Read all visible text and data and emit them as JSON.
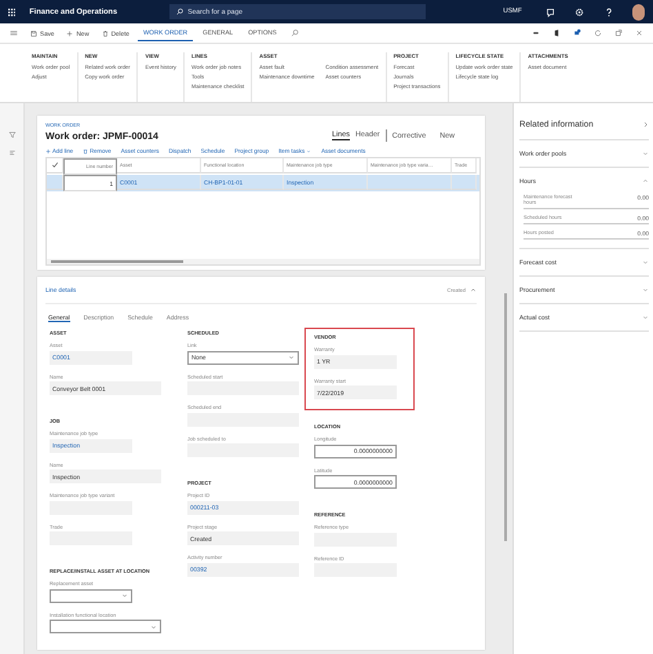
{
  "app": {
    "title": "Finance and Operations",
    "search_placeholder": "Search for a page",
    "company": "USMF"
  },
  "action_bar": {
    "buttons": [
      {
        "label": "Save",
        "kind": "save"
      },
      {
        "label": "New",
        "kind": "new"
      },
      {
        "label": "Delete",
        "kind": "delete"
      }
    ],
    "tabs": [
      {
        "label": "WORK ORDER",
        "selected": true
      },
      {
        "label": "GENERAL",
        "selected": false
      },
      {
        "label": "OPTIONS",
        "selected": false
      }
    ]
  },
  "ribbon": [
    {
      "title": "MAINTAIN",
      "columns": [
        [
          "Work order pool",
          "Adjust"
        ]
      ]
    },
    {
      "title": "NEW",
      "columns": [
        [
          "Related work order",
          "Copy work order"
        ]
      ]
    },
    {
      "title": "VIEW",
      "columns": [
        [
          "Event history"
        ]
      ]
    },
    {
      "title": "LINES",
      "columns": [
        [
          "Work order job notes",
          "Tools",
          "Maintenance checklist"
        ]
      ]
    },
    {
      "title": "ASSET",
      "columns": [
        [
          "Asset fault",
          "Maintenance downtime"
        ],
        [
          "Condition assessment",
          "Asset counters"
        ]
      ]
    },
    {
      "title": "PROJECT",
      "columns": [
        [
          "Forecast",
          "Journals",
          "Project transactions"
        ]
      ]
    },
    {
      "title": "LIFECYCLE STATE",
      "columns": [
        [
          "Update work order state",
          "Lifecycle state log"
        ]
      ]
    },
    {
      "title": "ATTACHMENTS",
      "columns": [
        [
          "Asset document"
        ]
      ]
    }
  ],
  "page": {
    "breadcrumb": "WORK ORDER",
    "title": "Work order: JPMF-00014",
    "view_tabs": [
      {
        "label": "Lines",
        "selected": true
      },
      {
        "label": "Header",
        "selected": false
      }
    ],
    "status": [
      "Corrective",
      "New"
    ]
  },
  "lines_toolbar": [
    {
      "label": "Add line",
      "kind": "add"
    },
    {
      "label": "Remove",
      "kind": "remove"
    },
    {
      "label": "Asset counters",
      "kind": "plain"
    },
    {
      "label": "Dispatch",
      "kind": "plain"
    },
    {
      "label": "Schedule",
      "kind": "plain"
    },
    {
      "label": "Project group",
      "kind": "plain"
    },
    {
      "label": "Item tasks",
      "kind": "menu"
    },
    {
      "label": "Asset documents",
      "kind": "plain"
    }
  ],
  "grid": {
    "columns": [
      "Line number",
      "Asset",
      "Functional location",
      "Maintenance job type",
      "Maintenance job type varia…",
      "Trade"
    ],
    "rows": [
      {
        "selected": true,
        "cells": [
          {
            "text": "1",
            "link": false
          },
          {
            "text": "C0001",
            "link": true
          },
          {
            "text": "CH-BP1-01-01",
            "link": true
          },
          {
            "text": "Inspection",
            "link": true
          }
        ]
      }
    ]
  },
  "line_details": {
    "title": "Line details",
    "status": "Created",
    "expanded": true,
    "tabs": [
      {
        "label": "General",
        "selected": true
      },
      {
        "label": "Description",
        "selected": false
      },
      {
        "label": "Schedule",
        "selected": false
      },
      {
        "label": "Address",
        "selected": false
      }
    ],
    "columns": [
      [
        {
          "title": "ASSET",
          "highlighted": false,
          "fields": [
            {
              "label": "Asset",
              "value": "C0001",
              "kind": "readonly",
              "link": true
            },
            {
              "label": "Name",
              "value": "Conveyor Belt 0001",
              "kind": "readonly",
              "link": false
            }
          ]
        },
        {
          "title": "JOB",
          "highlighted": false,
          "fields": [
            {
              "label": "Maintenance job type",
              "value": "Inspection",
              "kind": "readonly",
              "link": true
            },
            {
              "label": "Name",
              "value": "Inspection",
              "kind": "readonly",
              "link": false
            },
            {
              "label": "Maintenance job type variant",
              "kind": "readonly"
            },
            {
              "label": "Trade",
              "kind": "readonly"
            }
          ]
        },
        {
          "title": "REPLACE/INSTALL ASSET AT LOCATION",
          "highlighted": false,
          "fields": [
            {
              "label": "Replacement asset",
              "kind": "dropdown"
            },
            {
              "label": "Installation functional location",
              "kind": "dropdown"
            }
          ]
        }
      ],
      [
        {
          "title": "SCHEDULED",
          "highlighted": false,
          "fields": [
            {
              "label": "Link",
              "value": "None",
              "kind": "dropdown"
            },
            {
              "label": "Scheduled start",
              "kind": "readonly"
            },
            {
              "label": "Scheduled end",
              "kind": "readonly"
            },
            {
              "label": "Job scheduled to",
              "kind": "readonly"
            }
          ]
        },
        {
          "title": "PROJECT",
          "highlighted": false,
          "fields": [
            {
              "label": "Project ID",
              "value": "000211-03",
              "kind": "readonly",
              "link": true
            },
            {
              "label": "Project stage",
              "value": "Created",
              "kind": "readonly",
              "link": false
            },
            {
              "label": "Activity number",
              "value": "00392",
              "kind": "readonly",
              "link": true
            }
          ]
        }
      ],
      [
        {
          "title": "VENDOR",
          "highlighted": true,
          "fields": [
            {
              "label": "Warranty",
              "value": "1 YR",
              "kind": "readonly",
              "link": false
            },
            {
              "label": "Warranty start",
              "value": "7/22/2019",
              "kind": "readonly",
              "link": false
            }
          ]
        },
        {
          "title": "LOCATION",
          "highlighted": false,
          "fields": [
            {
              "label": "Longitude",
              "value": "0.0000000000",
              "kind": "number"
            },
            {
              "label": "Latitude",
              "value": "0.0000000000",
              "kind": "number"
            }
          ]
        },
        {
          "title": "REFERENCE",
          "highlighted": false,
          "fields": [
            {
              "label": "Reference type",
              "kind": "readonly"
            },
            {
              "label": "Reference ID",
              "kind": "readonly"
            }
          ]
        }
      ]
    ]
  },
  "related": {
    "title": "Related information",
    "sections": [
      {
        "title": "Work order pools",
        "expanded": false
      },
      {
        "title": "Hours",
        "expanded": true,
        "rows": [
          {
            "label": "Maintenance forecast hours",
            "value": "0.00"
          },
          {
            "label": "Scheduled hours",
            "value": "0.00"
          },
          {
            "label": "Hours posted",
            "value": "0.00"
          }
        ]
      },
      {
        "title": "Forecast cost",
        "expanded": false
      },
      {
        "title": "Procurement",
        "expanded": false
      },
      {
        "title": "Actual cost",
        "expanded": false
      }
    ]
  }
}
